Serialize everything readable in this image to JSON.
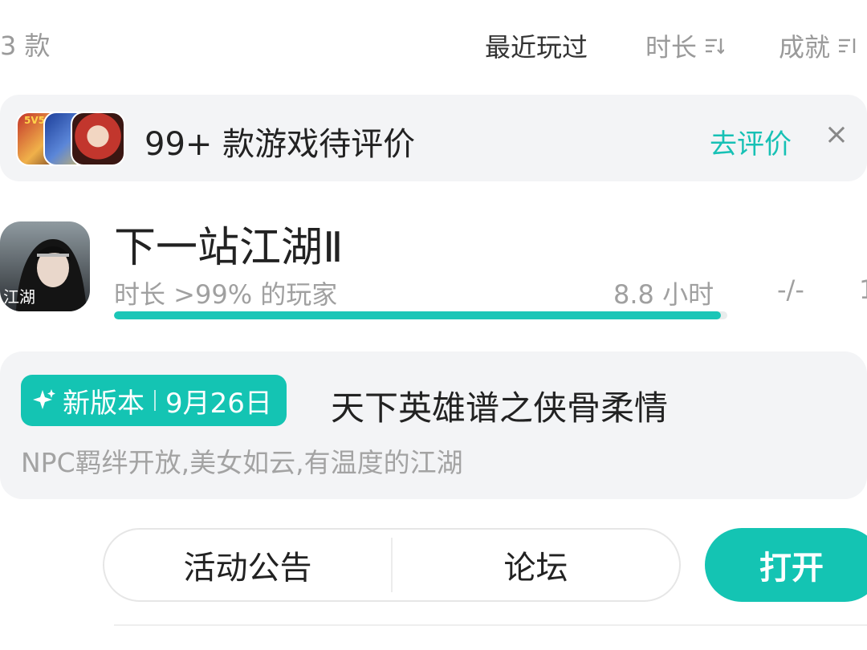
{
  "header": {
    "count_text": "3 款",
    "sorts": [
      {
        "label": "最近玩过",
        "active": true
      },
      {
        "label": "时长",
        "active": false
      },
      {
        "label": "成就",
        "active": false
      }
    ]
  },
  "review_banner": {
    "text": "99+ 款游戏待评价",
    "action": "去评价",
    "thumb_badge": "5V5"
  },
  "game": {
    "title": "下一站江湖Ⅱ",
    "icon_text": "江湖",
    "rank_text": "时长 >99% 的玩家",
    "hours_text": "8.8 小时",
    "progress_fraction": 0.99,
    "achievements_text": "-/-",
    "achievements_cut": "1"
  },
  "version": {
    "badge_label": "新版本",
    "badge_date": "9月26日",
    "title": "天下英雄谱之侠骨柔情",
    "desc": "NPC羁绊开放,美女如云,有温度的江湖"
  },
  "actions": {
    "announcement": "活动公告",
    "forum": "论坛",
    "open": "打开"
  },
  "colors": {
    "accent": "#14c4b3",
    "card_bg": "#f3f4f6"
  }
}
